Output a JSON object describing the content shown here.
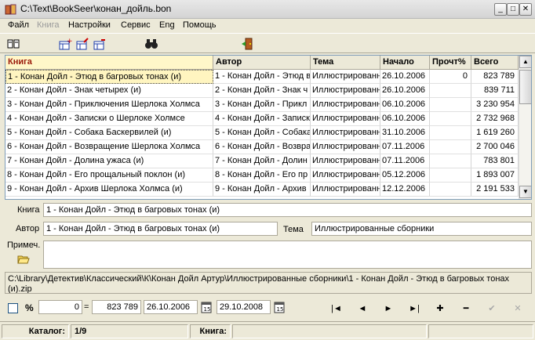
{
  "window": {
    "title": "C:\\Text\\BookSeer\\конан_дойль.bon",
    "min_glyph": "_",
    "max_glyph": "□",
    "close_glyph": "✕"
  },
  "menu": [
    "Файл",
    "Книга",
    "Настройки",
    "Сервис",
    "Eng",
    "Помощь"
  ],
  "grid": {
    "columns": [
      "Книга",
      "Автор",
      "Тема",
      "Начало",
      "Прочт%",
      "Всего"
    ],
    "rows": [
      [
        "1 - Конан Дойл - Этюд в багровых тонах (и)",
        "1 - Конан Дойл - Этюд в",
        "Иллюстрированн",
        "26.10.2006",
        "0",
        "823 789"
      ],
      [
        "2 - Конан Дойл - Знак четырех (и)",
        "2 - Конан Дойл - Знак ч",
        "Иллюстрированн",
        "26.10.2006",
        "",
        "839 711"
      ],
      [
        "3 - Конан Дойл - Приключения Шерлока Холмса",
        "3 - Конан Дойл - Прикл",
        "Иллюстрированн",
        "06.10.2006",
        "",
        "3 230 954"
      ],
      [
        "4 - Конан Дойл - Записки о Шерлоке Холмсе",
        "4 - Конан Дойл - Записк",
        "Иллюстрированн",
        "06.10.2006",
        "",
        "2 732 968"
      ],
      [
        "5 - Конан Дойл - Собака Баскервилей (и)",
        "5 - Конан Дойл - Собака",
        "Иллюстрированн",
        "31.10.2006",
        "",
        "1 619 260"
      ],
      [
        "6 - Конан Дойл - Возвращение Шерлока Холмса",
        "6 - Конан Дойл - Возвра",
        "Иллюстрированн",
        "07.11.2006",
        "",
        "2 700 046"
      ],
      [
        "7 - Конан Дойл - Долина ужаса (и)",
        "7 - Конан Дойл - Долин",
        "Иллюстрированн",
        "07.11.2006",
        "",
        "783 801"
      ],
      [
        "8 - Конан Дойл - Его прощальный поклон (и)",
        "8 - Конан Дойл - Его пр",
        "Иллюстрированн",
        "05.12.2006",
        "",
        "1 893 007"
      ],
      [
        "9 - Конан Дойл - Архив Шерлока Холмса (и)",
        "9 - Конан Дойл - Архив",
        "Иллюстрированн",
        "12.12.2006",
        "",
        "2 191 533"
      ]
    ]
  },
  "details": {
    "book_label": "Книга",
    "book_value": "1 - Конан Дойл - Этюд в багровых тонах (и)",
    "author_label": "Автор",
    "author_value": "1 - Конан Дойл - Этюд в багровых тонах (и)",
    "topic_label": "Тема",
    "topic_value": "Иллюстрированные сборники",
    "note_label": "Примеч.",
    "note_value": ""
  },
  "path": "C:\\Library\\Детектив\\Классический\\К\\Конан Дойл Артур\\Иллюстрированные сборники\\1 - Конан Дойл - Этюд в багровых тонах (и).zip",
  "progress": {
    "percent_label": "%",
    "read_value": "0",
    "equals": "=",
    "total_value": "823 789",
    "start_date": "26.10.2006",
    "end_date": "29.10.2008"
  },
  "nav": {
    "first": "|◄",
    "prev": "◄",
    "next": "►",
    "last": "►|",
    "add": "✚",
    "remove": "━",
    "confirm": "✔",
    "cancel": "✕"
  },
  "status": {
    "catalog_label": "Каталог:",
    "catalog_value": "1/9",
    "book_label": "Книга:",
    "book_value": ""
  },
  "colors": {
    "sorted_header_text": "#9b1a0a",
    "selected_row": "#fff5c0"
  }
}
